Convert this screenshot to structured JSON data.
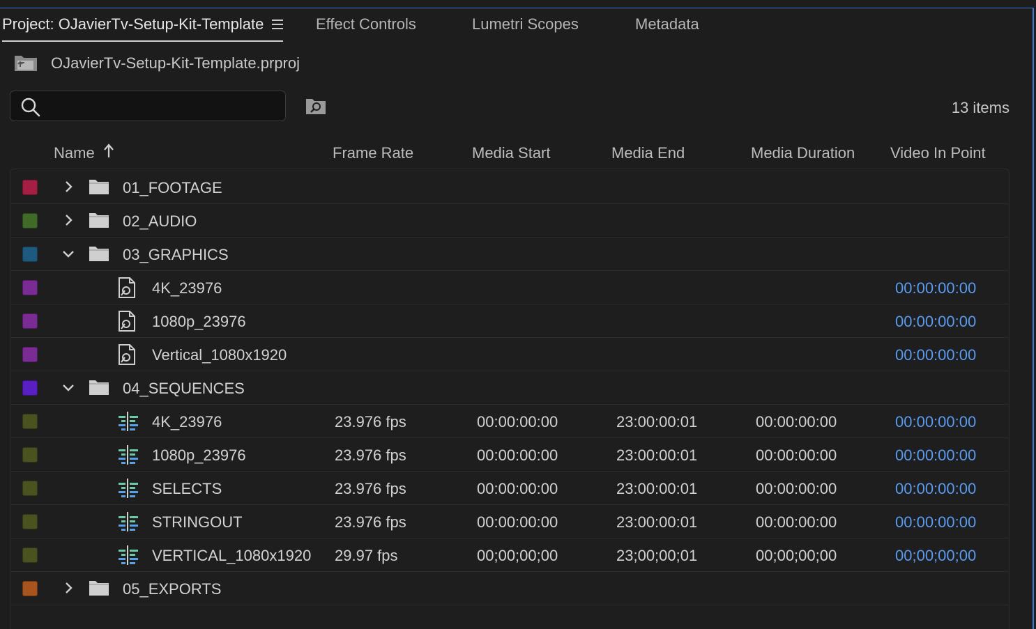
{
  "tabs": [
    {
      "label": "Project: OJavierTv-Setup-Kit-Template",
      "active": true
    },
    {
      "label": "Effect Controls",
      "active": false
    },
    {
      "label": "Lumetri Scopes",
      "active": false
    },
    {
      "label": "Metadata",
      "active": false
    }
  ],
  "project": {
    "filename": "OJavierTv-Setup-Kit-Template.prproj"
  },
  "search": {
    "value": "",
    "placeholder": ""
  },
  "items_count": "13 items",
  "columns": {
    "name": "Name",
    "frame_rate": "Frame Rate",
    "media_start": "Media Start",
    "media_end": "Media End",
    "media_duration": "Media Duration",
    "video_in_point": "Video In Point"
  },
  "rows": [
    {
      "type": "folder",
      "name": "01_FOOTAGE",
      "label_color": "#a51f45",
      "expanded": false,
      "frame_rate": "",
      "media_start": "",
      "media_end": "",
      "media_duration": "",
      "video_in_point": ""
    },
    {
      "type": "folder",
      "name": "02_AUDIO",
      "label_color": "#3f6a27",
      "expanded": false,
      "frame_rate": "",
      "media_start": "",
      "media_end": "",
      "media_duration": "",
      "video_in_point": ""
    },
    {
      "type": "folder",
      "name": "03_GRAPHICS",
      "label_color": "#1e5a80",
      "expanded": true,
      "frame_rate": "",
      "media_start": "",
      "media_end": "",
      "media_duration": "",
      "video_in_point": ""
    },
    {
      "type": "graphic",
      "name": "4K_23976",
      "label_color": "#7a2b94",
      "frame_rate": "",
      "media_start": "",
      "media_end": "",
      "media_duration": "",
      "video_in_point": "00:00:00:00"
    },
    {
      "type": "graphic",
      "name": "1080p_23976",
      "label_color": "#7a2b94",
      "frame_rate": "",
      "media_start": "",
      "media_end": "",
      "media_duration": "",
      "video_in_point": "00:00:00:00"
    },
    {
      "type": "graphic",
      "name": "Vertical_1080x1920",
      "label_color": "#7a2b94",
      "frame_rate": "",
      "media_start": "",
      "media_end": "",
      "media_duration": "",
      "video_in_point": "00:00:00:00"
    },
    {
      "type": "folder",
      "name": "04_SEQUENCES",
      "label_color": "#5a1fc2",
      "expanded": true,
      "frame_rate": "",
      "media_start": "",
      "media_end": "",
      "media_duration": "",
      "video_in_point": ""
    },
    {
      "type": "sequence",
      "name": "4K_23976",
      "label_color": "#4a5320",
      "frame_rate": "23.976 fps",
      "media_start": "00:00:00:00",
      "media_end": "23:00:00:01",
      "media_duration": "00:00:00:00",
      "video_in_point": "00:00:00:00"
    },
    {
      "type": "sequence",
      "name": "1080p_23976",
      "label_color": "#4a5320",
      "frame_rate": "23.976 fps",
      "media_start": "00:00:00:00",
      "media_end": "23:00:00:01",
      "media_duration": "00:00:00:00",
      "video_in_point": "00:00:00:00"
    },
    {
      "type": "sequence",
      "name": "SELECTS",
      "label_color": "#4a5320",
      "frame_rate": "23.976 fps",
      "media_start": "00:00:00:00",
      "media_end": "23:00:00:01",
      "media_duration": "00:00:00:00",
      "video_in_point": "00:00:00:00"
    },
    {
      "type": "sequence",
      "name": "STRINGOUT",
      "label_color": "#4a5320",
      "frame_rate": "23.976 fps",
      "media_start": "00:00:00:00",
      "media_end": "23:00:00:01",
      "media_duration": "00:00:00:00",
      "video_in_point": "00:00:00:00"
    },
    {
      "type": "sequence",
      "name": "VERTICAL_1080x1920",
      "label_color": "#4a5320",
      "frame_rate": "29.97 fps",
      "media_start": "00;00;00;00",
      "media_end": "23;00;00;01",
      "media_duration": "00;00;00;00",
      "video_in_point": "00;00;00;00"
    },
    {
      "type": "folder",
      "name": "05_EXPORTS",
      "label_color": "#a8541e",
      "expanded": false,
      "frame_rate": "",
      "media_start": "",
      "media_end": "",
      "media_duration": "",
      "video_in_point": ""
    }
  ],
  "colors": {
    "accent": "#3a78d1",
    "timecode": "#5a9bf1",
    "background": "#1d1d1d"
  }
}
